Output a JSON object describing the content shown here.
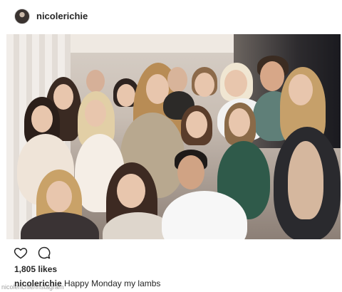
{
  "post": {
    "username": "nicolerichie",
    "likes": "1,805 likes",
    "caption_user": "nicolerichie",
    "caption_text": "Happy Monday my lambs"
  },
  "watermark": "nicolerichie/Instagram",
  "icons": {
    "like": "heart-icon",
    "comment": "comment-icon"
  },
  "colors": {
    "text": "#262626",
    "background": "#ffffff",
    "border": "#dbdbdb"
  }
}
